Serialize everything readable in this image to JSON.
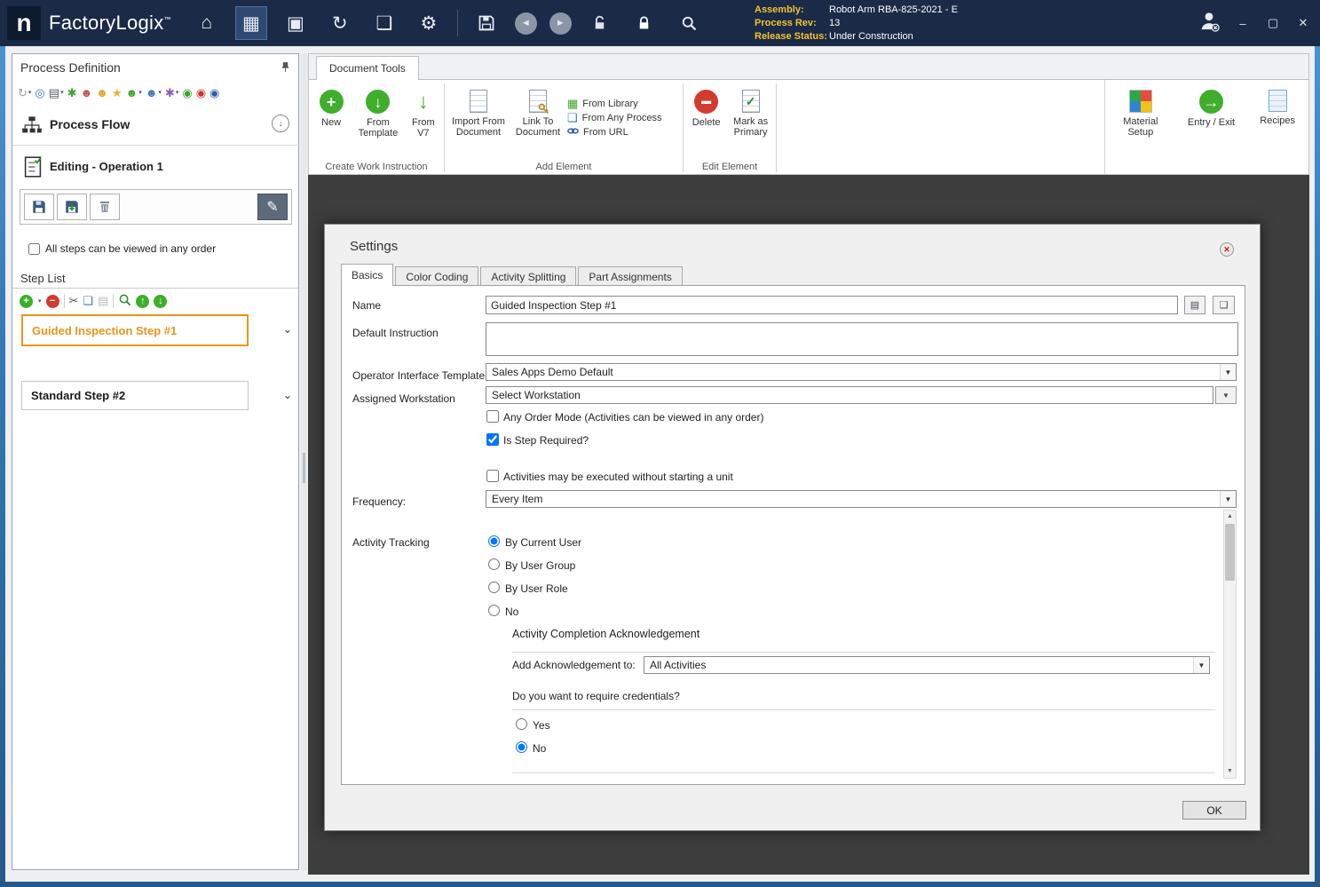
{
  "titlebar": {
    "logo_letter": "n",
    "app_name": "FactoryLogix",
    "tm": "™",
    "info": {
      "assembly_label": "Assembly:",
      "assembly_value": "Robot Arm RBA-825-2021 - E",
      "process_rev_label": "Process Rev:",
      "process_rev_value": "13",
      "release_status_label": "Release Status:",
      "release_status_value": "Under Construction"
    },
    "window": {
      "minimize": "–",
      "maximize": "▢",
      "close": "✕"
    }
  },
  "icons": {
    "home": "⌂",
    "work_instructions": "▦",
    "process": "▣",
    "sync": "↻",
    "documents": "❏",
    "gear": "⚙",
    "back": "◄",
    "forward": "►",
    "caret": "▾",
    "chevron": "⌄",
    "plus": "+",
    "minus": "−",
    "bar": "▬",
    "cut": "✂",
    "copy": "❏",
    "paste": "▤",
    "up": "↑",
    "down": "↓",
    "check": "✓",
    "grid": "▦",
    "refresh": "↻",
    "globe": "◎",
    "print": "▤",
    "asterisk": "✱",
    "person": "☻",
    "star": "★",
    "ring": "◉",
    "arrow_right": "→",
    "scroll_up": "▲",
    "scroll_down": "▼",
    "x": "✕",
    "pencil": "✎"
  },
  "sidebar": {
    "title": "Process Definition",
    "process_flow": "Process Flow",
    "editing": "Editing - Operation 1",
    "any_order": "All steps can be viewed in any order",
    "step_list_title": "Step List",
    "steps": [
      {
        "label": "Guided Inspection Step #1"
      },
      {
        "label": "Standard Step #2"
      }
    ]
  },
  "ribbon": {
    "tab": "Document Tools",
    "create_group": {
      "label": "Create Work Instruction",
      "new": "New",
      "from_template": "From Template",
      "from_v7": "From V7"
    },
    "add_group": {
      "label": "Add Element",
      "import": "Import From Document",
      "link": "Link To Document",
      "from_library": "From Library",
      "from_any_process": "From Any Process",
      "from_url": "From URL"
    },
    "edit_group": {
      "label": "Edit Element",
      "delete": "Delete",
      "mark_primary": "Mark as Primary"
    },
    "right": {
      "material_setup": "Material Setup",
      "entry_exit": "Entry / Exit",
      "recipes": "Recipes"
    }
  },
  "dialog": {
    "title": "Settings",
    "tabs": [
      {
        "label": "Basics"
      },
      {
        "label": "Color Coding"
      },
      {
        "label": "Activity Splitting"
      },
      {
        "label": "Part Assignments"
      }
    ],
    "name_label": "Name",
    "name_value": "Guided Inspection Step #1",
    "default_instruction_label": "Default Instruction",
    "oit_label": "Operator Interface Template",
    "oit_value": "Sales Apps Demo Default",
    "workstation_label": "Assigned Workstation",
    "workstation_value": "Select Workstation",
    "any_order_mode": "Any Order Mode (Activities can be viewed in any order)",
    "is_step_required": "Is Step Required?",
    "activities_no_unit": "Activities may be executed without starting a unit",
    "frequency_label": "Frequency:",
    "frequency_value": "Every Item",
    "activity_tracking_label": "Activity Tracking",
    "tracking_options": [
      {
        "label": "By Current User",
        "selected": true
      },
      {
        "label": "By User Group",
        "selected": false
      },
      {
        "label": "By User Role",
        "selected": false
      },
      {
        "label": "No",
        "selected": false
      }
    ],
    "ack_title": "Activity Completion Acknowledgement",
    "ack_label": "Add Acknowledgement to:",
    "ack_value": "All Activities",
    "credentials_question": "Do you want to require credentials?",
    "credentials_options": [
      {
        "label": "Yes",
        "selected": false
      },
      {
        "label": "No",
        "selected": true
      }
    ],
    "ok": "OK"
  }
}
